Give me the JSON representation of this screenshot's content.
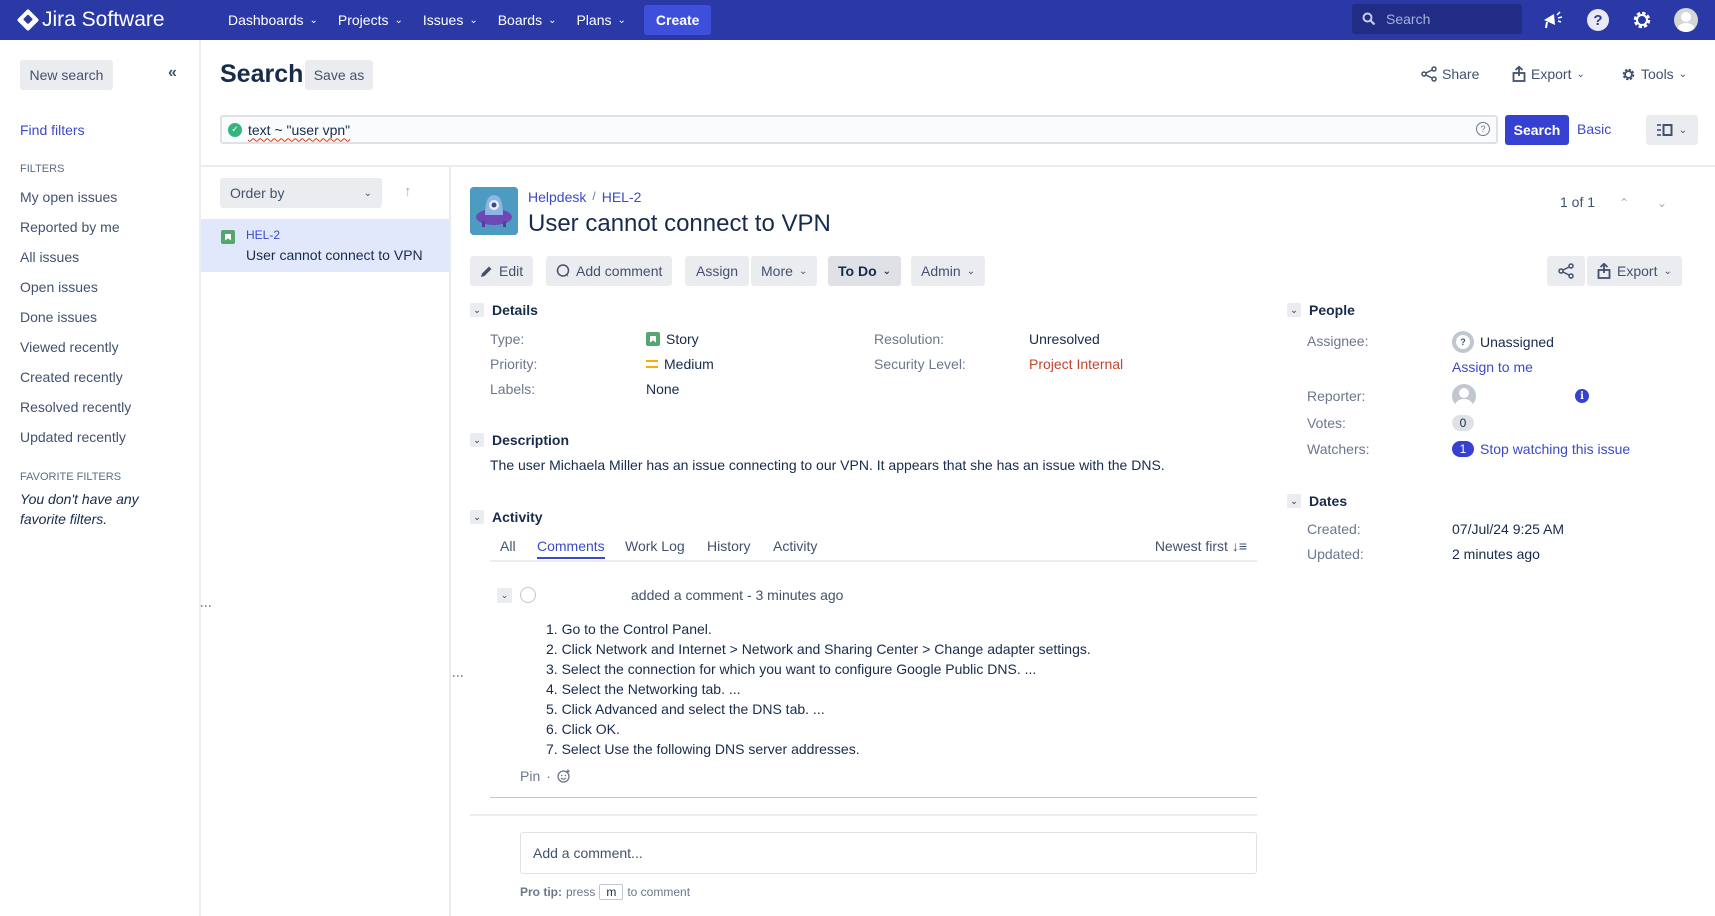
{
  "topnav": {
    "product": "Jira Software",
    "items": [
      {
        "label": "Dashboards"
      },
      {
        "label": "Projects"
      },
      {
        "label": "Issues"
      },
      {
        "label": "Boards"
      },
      {
        "label": "Plans"
      }
    ],
    "create_label": "Create",
    "search_placeholder": "Search",
    "icons": [
      "notifications-megaphone-icon",
      "help-icon",
      "settings-gear-icon",
      "user-avatar"
    ],
    "colors": {
      "nav_bg": "#2a39a6",
      "create_bg": "#3d4fdb"
    }
  },
  "sidebar": {
    "new_search_label": "New search",
    "collapse_glyph": "«",
    "find_filters_label": "Find filters",
    "filters_heading": "FILTERS",
    "filters": [
      "My open issues",
      "Reported by me",
      "All issues",
      "Open issues",
      "Done issues",
      "Viewed recently",
      "Created recently",
      "Resolved recently",
      "Updated recently"
    ],
    "favorite_heading": "FAVORITE FILTERS",
    "favorite_empty": "You don't have any favorite filters."
  },
  "search_header": {
    "title": "Search",
    "save_as_label": "Save as",
    "actions": {
      "share": "Share",
      "export": "Export",
      "tools": "Tools"
    },
    "jql_query": "text ~ \"user vpn\"",
    "search_button": "Search",
    "basic_link": "Basic"
  },
  "issue_list": {
    "order_by_label": "Order by",
    "items": [
      {
        "key": "HEL-2",
        "summary": "User cannot connect to VPN",
        "type": "Story",
        "selected": true
      }
    ]
  },
  "issue": {
    "project": "Helpdesk",
    "key": "HEL-2",
    "breadcrumb_sep": "/",
    "title": "User cannot connect to VPN",
    "pager": "1 of 1",
    "toolbar": {
      "edit": "Edit",
      "add_comment": "Add comment",
      "assign": "Assign",
      "more": "More",
      "status": "To Do",
      "admin": "Admin",
      "export": "Export"
    },
    "details": {
      "heading": "Details",
      "type_label": "Type:",
      "type_value": "Story",
      "priority_label": "Priority:",
      "priority_value": "Medium",
      "labels_label": "Labels:",
      "labels_value": "None",
      "resolution_label": "Resolution:",
      "resolution_value": "Unresolved",
      "security_label": "Security Level:",
      "security_value": "Project Internal"
    },
    "description": {
      "heading": "Description",
      "text": "The user Michaela Miller has an issue connecting to our VPN. It appears that she has an issue with the DNS."
    },
    "activity": {
      "heading": "Activity",
      "tabs": [
        "All",
        "Comments",
        "Work Log",
        "History",
        "Activity"
      ],
      "active_tab": "Comments",
      "sort_label": "Newest first",
      "comment": {
        "meta": "added a comment - 3 minutes ago",
        "steps": [
          "1. Go to the Control Panel.",
          "2. Click Network and Internet > Network and Sharing Center > Change adapter settings.",
          "3. Select the connection for which you want to configure Google Public DNS. ...",
          "4. Select the Networking tab. ...",
          "5. Click Advanced and select the DNS tab. ...",
          "6. Click OK.",
          "7. Select Use the following DNS server addresses."
        ],
        "pin_label": "Pin",
        "dot": "·"
      },
      "add_comment_placeholder": "Add a comment...",
      "pro_tip_label": "Pro tip:",
      "pro_tip_press": "press",
      "pro_tip_key": "m",
      "pro_tip_suffix": "to comment"
    },
    "people": {
      "heading": "People",
      "assignee_label": "Assignee:",
      "assignee_value": "Unassigned",
      "assign_to_me": "Assign to me",
      "reporter_label": "Reporter:",
      "votes_label": "Votes:",
      "votes_value": "0",
      "watchers_label": "Watchers:",
      "watchers_count": "1",
      "stop_watching": "Stop watching this issue"
    },
    "dates": {
      "heading": "Dates",
      "created_label": "Created:",
      "created_value": "07/Jul/24 9:25 AM",
      "updated_label": "Updated:",
      "updated_value": "2 minutes ago"
    }
  }
}
